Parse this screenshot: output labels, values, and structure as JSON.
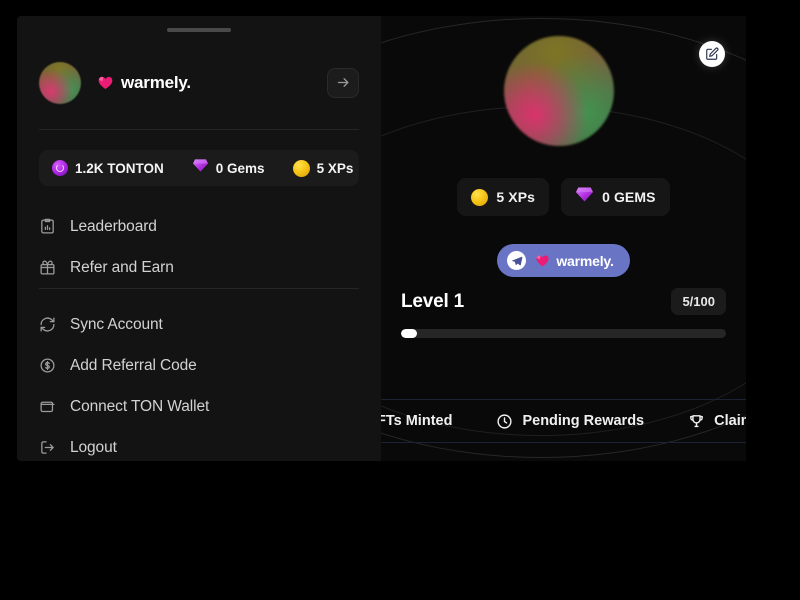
{
  "app": {
    "brand_name": "warmely.",
    "accent_pink": "#ec1c74",
    "telegram_badge_bg": "#6a74c4",
    "panel_bg": "#090909",
    "drawer_bg": "#131313"
  },
  "drawer": {
    "drag_handle": "drag-handle",
    "profile": {
      "name": "warmely.",
      "avatar": "user-avatar",
      "open_icon": "arrow-right-icon"
    },
    "balances": [
      {
        "icon": "tonton-coin-icon",
        "label": "1.2K TONTON"
      },
      {
        "icon": "gem-icon",
        "label": "0 Gems"
      },
      {
        "icon": "xp-coin-icon",
        "label": "5 XPs"
      }
    ],
    "menu_primary": [
      {
        "icon": "leaderboard-icon",
        "label": "Leaderboard"
      },
      {
        "icon": "gift-icon",
        "label": "Refer and Earn"
      }
    ],
    "menu_secondary": [
      {
        "icon": "sync-icon",
        "label": "Sync Account"
      },
      {
        "icon": "dollar-circle-icon",
        "label": "Add Referral Code"
      },
      {
        "icon": "wallet-icon",
        "label": "Connect TON Wallet"
      },
      {
        "icon": "logout-icon",
        "label": "Logout"
      }
    ]
  },
  "main": {
    "avatar": "profile-avatar",
    "edit_button": "edit-profile-icon",
    "stats": [
      {
        "icon": "xp-coin-icon",
        "label": "5 XPs"
      },
      {
        "icon": "gem-icon",
        "label": "0 GEMS"
      }
    ],
    "telegram": {
      "icon": "telegram-icon",
      "username": "warmely."
    },
    "level": {
      "title": "Level 1",
      "counter": "5/100",
      "progress_percent": 5
    },
    "tabs": [
      {
        "icon": "nft-icon",
        "label": "FTs Minted"
      },
      {
        "icon": "clock-icon",
        "label": "Pending Rewards"
      },
      {
        "icon": "trophy-icon",
        "label": "Claimed"
      }
    ]
  }
}
